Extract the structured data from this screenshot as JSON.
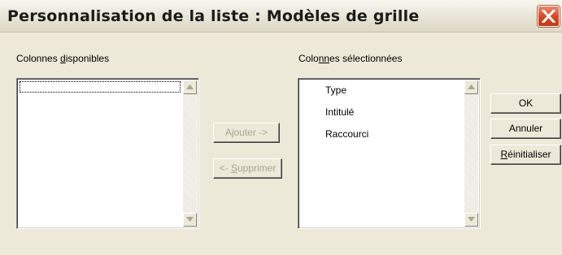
{
  "window": {
    "title": "Personnalisation de la liste : Modèles de grille"
  },
  "available": {
    "label": "Colonnes disponibles",
    "items": []
  },
  "selected": {
    "label": "Colonnes sélectionnées",
    "items": [
      "Type",
      "Intitulé",
      "Raccourci"
    ]
  },
  "buttons": {
    "add": "Ajouter ->",
    "remove": "<- Supprimer",
    "ok": "OK",
    "cancel": "Annuler",
    "reset": "Réinitialiser"
  },
  "colors": {
    "dialog_bg": "#ece9d8",
    "close_red": "#d4461f",
    "disabled_text": "#a8a597"
  },
  "icons": {
    "close": "close-icon",
    "scroll_up": "arrow-up-icon",
    "scroll_down": "arrow-down-icon"
  }
}
